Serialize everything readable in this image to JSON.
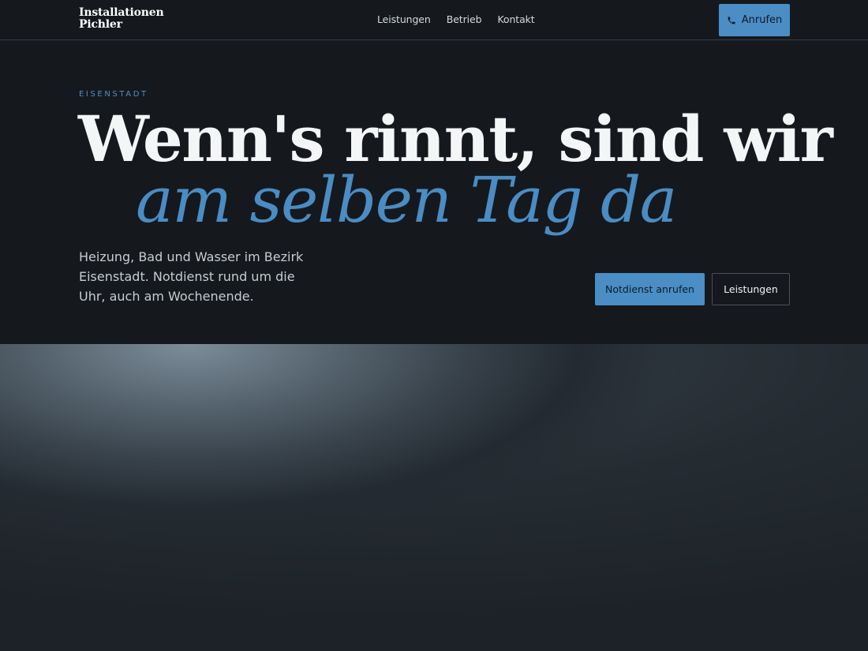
{
  "brand": {
    "line1": "Installationen",
    "line2": "Pichler"
  },
  "nav": {
    "items": [
      "Leistungen",
      "Betrieb",
      "Kontakt"
    ]
  },
  "header": {
    "call_label": "Anrufen",
    "call_icon": "phone-icon"
  },
  "hero": {
    "eyebrow": "EISENSTADT",
    "headline_line1": "Wenn's rinnt, sind wir",
    "headline_line2": "am selben Tag da",
    "lede": "Heizung, Bad und Wasser im Bezirk Eisenstadt. Notdienst rund um die Uhr, auch am Wochenende.",
    "primary_cta": "Notdienst anrufen",
    "secondary_cta": "Leistungen"
  },
  "colors": {
    "background": "#15191e",
    "accent": "#4a8ec5",
    "text": "#f3f5f7"
  }
}
